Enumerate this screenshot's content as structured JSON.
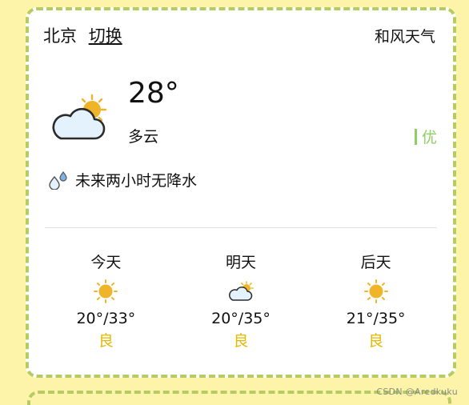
{
  "header": {
    "city": "北京",
    "switch_label": "切换",
    "brand": "和风天气"
  },
  "now": {
    "icon": "partly-cloudy-icon",
    "temperature": "28°",
    "condition": "多云",
    "aqi_label": "优",
    "rain_icon": "raindrops-icon",
    "rain_text": "未来两小时无降水"
  },
  "forecast": [
    {
      "day": "今天",
      "icon": "sunny-icon",
      "temp": "20°/33°",
      "aqi": "良"
    },
    {
      "day": "明天",
      "icon": "partly-cloudy-icon",
      "temp": "20°/35°",
      "aqi": "良"
    },
    {
      "day": "后天",
      "icon": "sunny-icon",
      "temp": "21°/35°",
      "aqi": "良"
    }
  ],
  "colors": {
    "background": "#fdf4a9",
    "border": "#b5cc63",
    "aqi_good_excellent": "#8fce62",
    "aqi_good": "#e6b800",
    "sun": "#f0b428"
  },
  "watermark": "CSDN @Aredkuku"
}
